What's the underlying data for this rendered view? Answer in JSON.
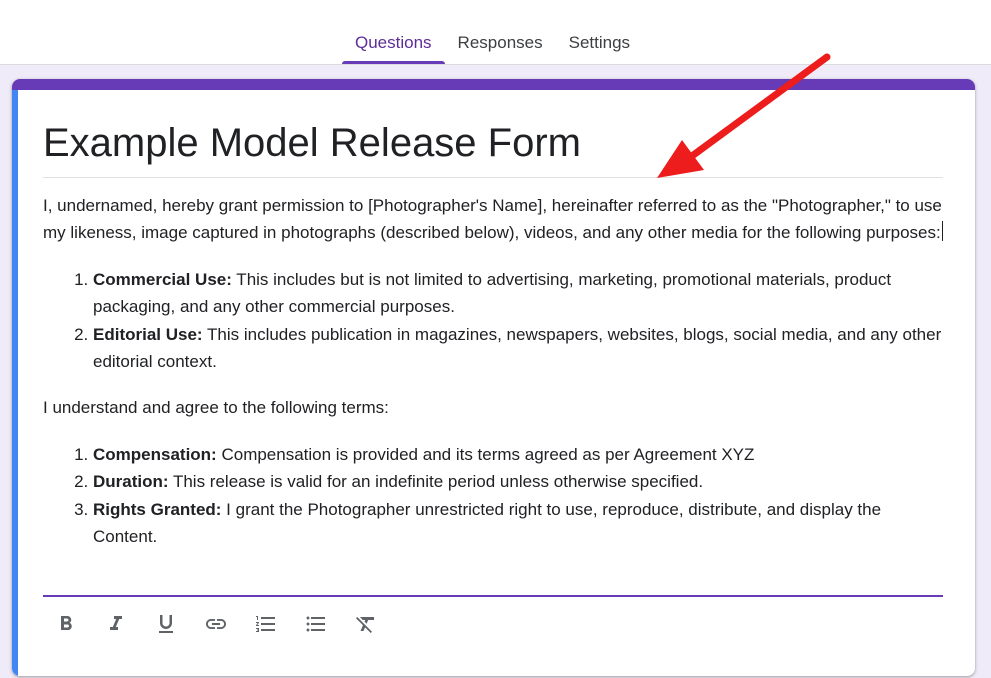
{
  "tabs": [
    {
      "label": "Questions",
      "active": true
    },
    {
      "label": "Responses",
      "active": false
    },
    {
      "label": "Settings",
      "active": false
    }
  ],
  "form": {
    "title": "Example Model Release Form",
    "intro": "I, undernamed, hereby grant permission to [Photographer's Name], hereinafter referred to as the \"Photographer,\" to use my likeness, image captured in photographs (described below), videos, and any other media for the following purposes:",
    "purposes": [
      {
        "term": "Commercial Use:",
        "text": " This includes but is not limited to advertising, marketing, promotional materials, product packaging, and any other commercial purposes."
      },
      {
        "term": "Editorial Use:",
        "text": " This includes publication in magazines, newspapers, websites, blogs, social media, and any other editorial context."
      }
    ],
    "agree_text": "I understand and agree to the following terms:",
    "terms": [
      {
        "term": "Compensation:",
        "text": " Compensation is provided and its terms agreed as per Agreement XYZ"
      },
      {
        "term": "Duration:",
        "text": " This release is valid for an indefinite period unless otherwise specified."
      },
      {
        "term": "Rights Granted:",
        "text": " I grant the Photographer unrestricted right to use, reproduce, distribute, and display the Content."
      }
    ]
  },
  "toolbar": {
    "icons": [
      "bold-icon",
      "italic-icon",
      "underline-icon",
      "link-icon",
      "numbered-list-icon",
      "bulleted-list-icon",
      "clear-formatting-icon"
    ]
  },
  "colors": {
    "accent": "#673ab7",
    "active_tab_text": "#5f2d9a",
    "focus_bar": "#4285f4",
    "background": "#f0ebf8",
    "annotation_arrow": "#ee1d1d"
  }
}
